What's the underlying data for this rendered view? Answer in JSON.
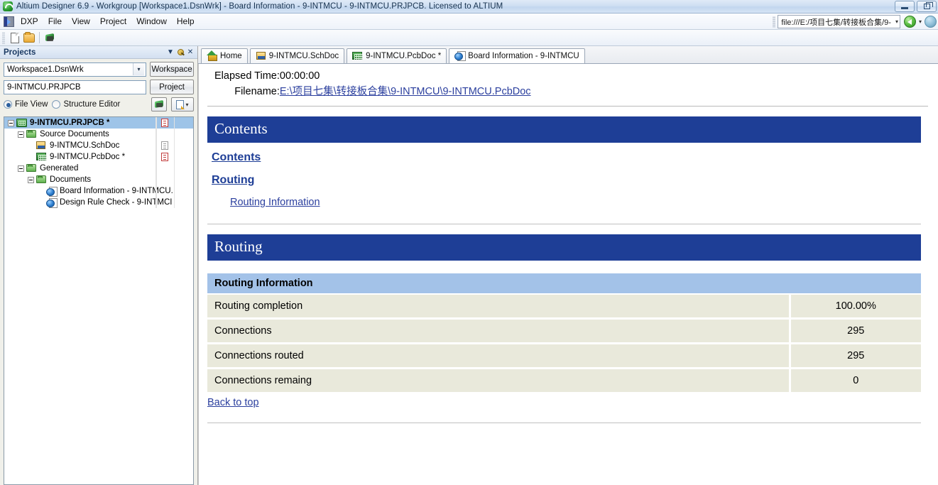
{
  "window": {
    "title": "Altium Designer 6.9 - Workgroup [Workspace1.DsnWrk] - Board Information - 9-INTMCU - 9-INTMCU.PRJPCB. Licensed to ALTIUM",
    "app_icon": "altium-icon",
    "minimize_label": "Minimize",
    "restore_label": "Restore"
  },
  "menubar": {
    "items": [
      {
        "label": "DXP"
      },
      {
        "label": "File"
      },
      {
        "label": "View"
      },
      {
        "label": "Project"
      },
      {
        "label": "Window"
      },
      {
        "label": "Help"
      }
    ],
    "nav": {
      "url": "file:///E:/项目七集/转接板合集/9-",
      "caret": "▾",
      "back_icon": "back-arrow-icon",
      "forward_icon": "forward-arrow-icon"
    }
  },
  "toolbar": {
    "buttons": [
      {
        "name": "new-document",
        "icon": "new-document-icon"
      },
      {
        "name": "open-document",
        "icon": "open-folder-icon"
      },
      {
        "name": "pcb-view",
        "icon": "pcb-board-icon"
      }
    ]
  },
  "panel": {
    "title": "Projects",
    "header_icons": [
      "chevron-down-icon",
      "pin-icon",
      "close-icon"
    ],
    "workspace_combo": {
      "value": "Workspace1.DsnWrk",
      "caret": "▾"
    },
    "workspace_button": "Workspace",
    "project_field": {
      "value": "9-INTMCU.PRJPCB"
    },
    "project_button": "Project",
    "view_modes": [
      {
        "label": "File View",
        "selected": true
      },
      {
        "label": "Structure Editor",
        "selected": false
      }
    ],
    "tree": [
      {
        "label": "9-INTMCU.PRJPCB *",
        "indent": 0,
        "icon": "project-icon",
        "expander": true,
        "selected": true,
        "status": "doc-red"
      },
      {
        "label": "Source Documents",
        "indent": 1,
        "icon": "folder-icon",
        "expander": true,
        "selected": false,
        "status": ""
      },
      {
        "label": "9-INTMCU.SchDoc",
        "indent": 2,
        "icon": "schematic-icon",
        "expander": false,
        "selected": false,
        "status": "doc-gray"
      },
      {
        "label": "9-INTMCU.PcbDoc *",
        "indent": 2,
        "icon": "pcb-icon",
        "expander": false,
        "selected": false,
        "status": "doc-red"
      },
      {
        "label": "Generated",
        "indent": 1,
        "icon": "folder-icon",
        "expander": true,
        "selected": false,
        "status": ""
      },
      {
        "label": "Documents",
        "indent": 2,
        "icon": "folder-icon",
        "expander": true,
        "selected": false,
        "status": ""
      },
      {
        "label": "Board Information - 9-INTMCU.",
        "indent": 3,
        "icon": "html-document-icon",
        "expander": false,
        "selected": false,
        "status": ""
      },
      {
        "label": "Design Rule Check - 9-INTMCI",
        "indent": 3,
        "icon": "html-document-icon",
        "expander": false,
        "selected": false,
        "status": ""
      }
    ]
  },
  "tabs": [
    {
      "label": "Home",
      "icon": "home-icon",
      "active": false
    },
    {
      "label": "9-INTMCU.SchDoc",
      "icon": "schematic-icon",
      "active": false
    },
    {
      "label": "9-INTMCU.PcbDoc *",
      "icon": "pcb-icon",
      "active": false
    },
    {
      "label": "Board Information - 9-INTMCU",
      "icon": "html-document-icon",
      "active": true
    }
  ],
  "report": {
    "meta": [
      {
        "label": "Elapsed Time",
        "colon": ":",
        "value": "00:00:00",
        "is_link": false
      },
      {
        "label": "Filename",
        "colon": ":",
        "value": "E:\\项目七集\\转接板合集\\9-INTMCU\\9-INTMCU.PcbDoc",
        "is_link": true
      }
    ],
    "contents_banner": "Contents",
    "toc": {
      "level1": [
        {
          "label": "Contents"
        },
        {
          "label": "Routing"
        }
      ],
      "level2": [
        {
          "label": "Routing Information"
        }
      ]
    },
    "routing_banner": "Routing",
    "routing_section_title": "Routing Information",
    "routing_rows": [
      {
        "name": "Routing completion",
        "value": "100.00%"
      },
      {
        "name": "Connections",
        "value": "295"
      },
      {
        "name": "Connections routed",
        "value": "295"
      },
      {
        "name": "Connections remaing",
        "value": "0"
      }
    ],
    "back_to_top": "Back to top"
  },
  "colors": {
    "banner_blue": "#1e3e96",
    "subhead_blue": "#a3c2e8",
    "row_cream": "#e9e9db",
    "link_blue": "#2b3f9e",
    "selection_blue": "#9ec4e8"
  }
}
